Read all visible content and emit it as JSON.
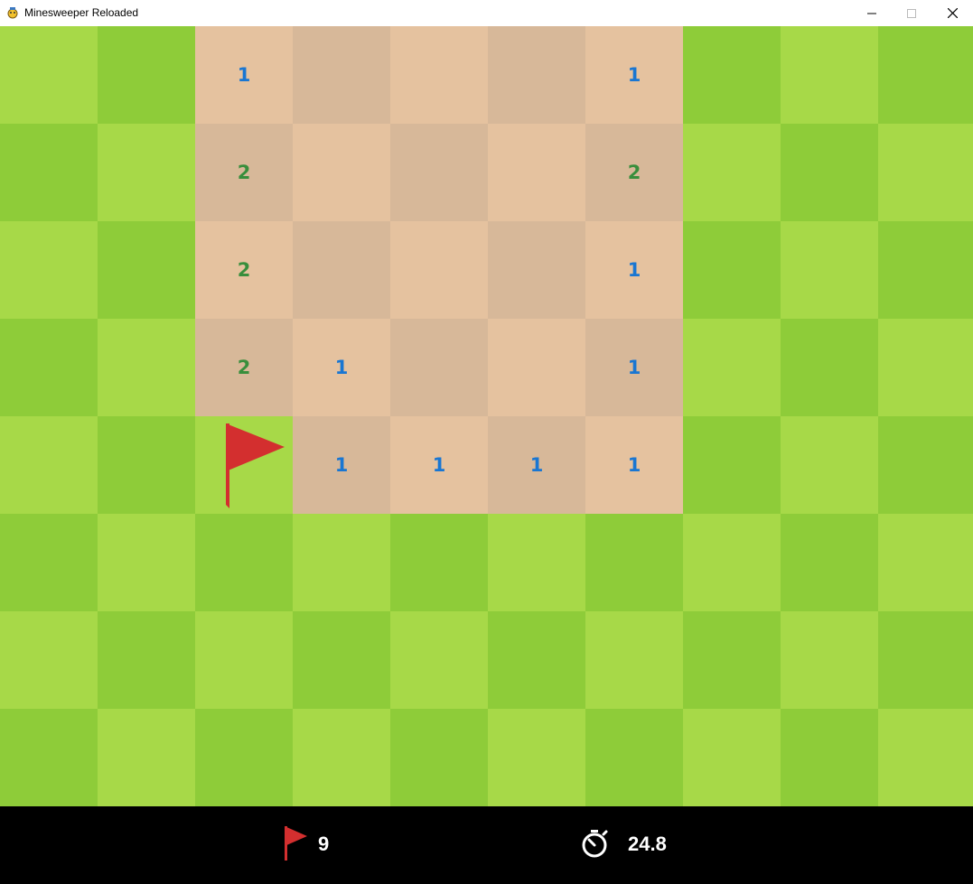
{
  "window": {
    "title": "Minesweeper Reloaded",
    "controls": [
      "minimize",
      "maximize",
      "close"
    ]
  },
  "colors": {
    "grass_light": "#a7d948",
    "grass_dark": "#8ecc39",
    "dirt_light": "#e5c29f",
    "dirt_dark": "#d7b899",
    "number_1": "#1976d2",
    "number_2": "#388e3c",
    "flag": "#d32f2f",
    "hud_bg": "#000000"
  },
  "board": {
    "rows": 8,
    "cols": 10,
    "cells": [
      [
        "",
        "",
        "1",
        "r",
        "r",
        "r",
        "1",
        "",
        "",
        ""
      ],
      [
        "",
        "",
        "2",
        "r",
        "r",
        "r",
        "2",
        "",
        "",
        ""
      ],
      [
        "",
        "",
        "2",
        "r",
        "r",
        "r",
        "1",
        "",
        "",
        ""
      ],
      [
        "",
        "",
        "2",
        "1",
        "r",
        "r",
        "1",
        "",
        "",
        ""
      ],
      [
        "",
        "",
        "F",
        "1",
        "1",
        "1",
        "1",
        "",
        "",
        ""
      ],
      [
        "",
        "",
        "",
        "",
        "",
        "",
        "",
        "",
        "",
        ""
      ],
      [
        "",
        "",
        "",
        "",
        "",
        "",
        "",
        "",
        "",
        ""
      ],
      [
        "",
        "",
        "",
        "",
        "",
        "",
        "",
        "",
        "",
        ""
      ]
    ]
  },
  "hud": {
    "flags_remaining": "9",
    "time_elapsed": "24.8",
    "flag_icon": "flag-icon",
    "timer_icon": "stopwatch-icon"
  }
}
